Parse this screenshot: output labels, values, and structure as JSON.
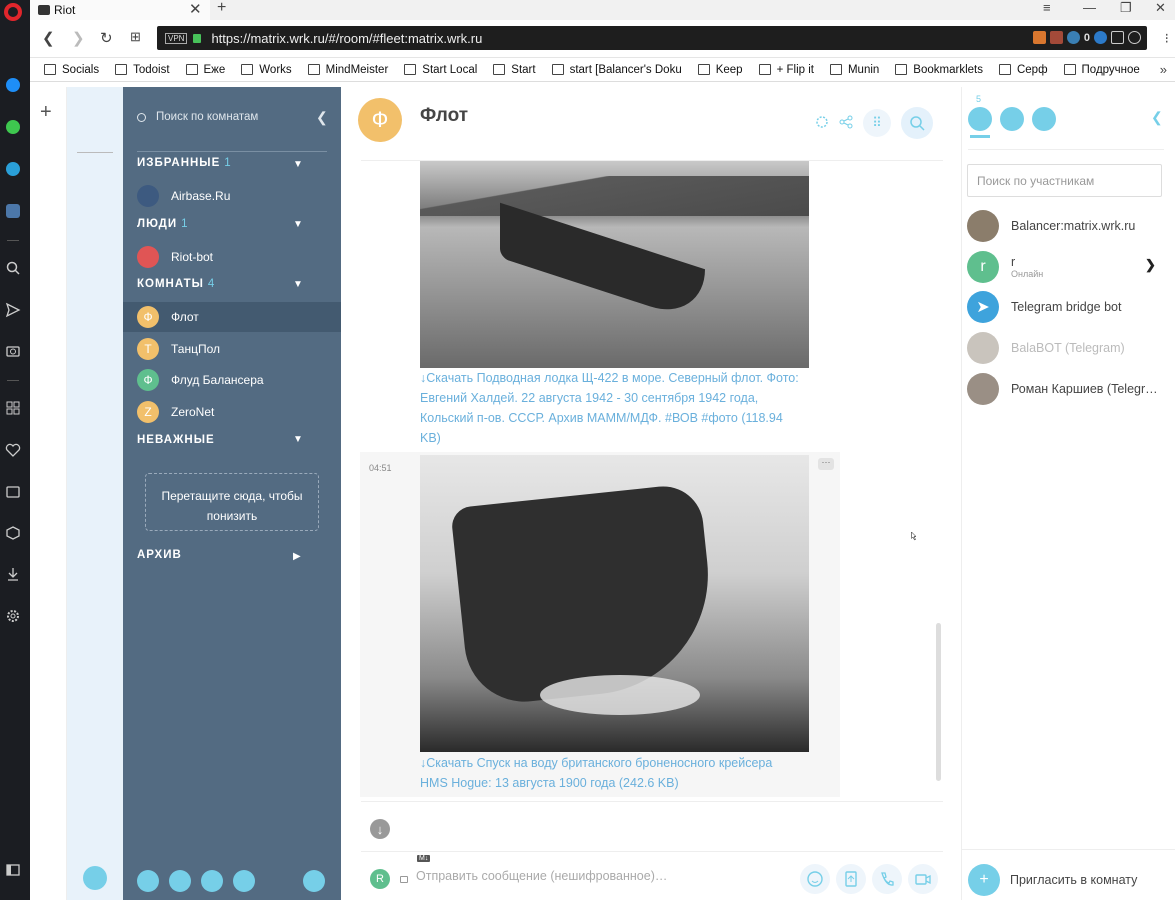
{
  "browser": {
    "tab_title": "Riot",
    "url": "https://matrix.wrk.ru/#/room/#fleet:matrix.wrk.ru",
    "vpn_label": "VPN",
    "ext_counter": "0",
    "bookmarks": [
      {
        "label": "Socials",
        "icon": "folder-icon"
      },
      {
        "label": "Todoist",
        "icon": "todoist-icon"
      },
      {
        "label": "Еже",
        "icon": "folder-icon"
      },
      {
        "label": "Works",
        "icon": "folder-icon"
      },
      {
        "label": "MindMeister",
        "icon": "mindmeister-icon"
      },
      {
        "label": "Start Local",
        "icon": "page-icon"
      },
      {
        "label": "Start",
        "icon": "home-icon"
      },
      {
        "label": "start [Balancer's Doku",
        "icon": "page-icon"
      },
      {
        "label": "Keep",
        "icon": "keep-icon"
      },
      {
        "label": "+ Flip it",
        "icon": "star-icon"
      },
      {
        "label": "Munin",
        "icon": "munin-icon"
      },
      {
        "label": "Bookmarklets",
        "icon": "folder-icon"
      },
      {
        "label": "Серф",
        "icon": "star-icon"
      },
      {
        "label": "Подручное",
        "icon": "folder-icon"
      }
    ]
  },
  "roomlist": {
    "search_placeholder": "Поиск по комнатам",
    "sections": {
      "favourites": {
        "label": "ИЗБРАННЫЕ",
        "count": "1"
      },
      "people": {
        "label": "ЛЮДИ",
        "count": "1"
      },
      "rooms": {
        "label": "КОМНАТЫ",
        "count": "4"
      },
      "low_priority": {
        "label": "НЕВАЖНЫЕ"
      },
      "archive": {
        "label": "АРХИВ"
      }
    },
    "favourite_rooms": [
      {
        "name": "Airbase.Ru"
      }
    ],
    "people": [
      {
        "name": "Riot-bot"
      }
    ],
    "rooms": [
      {
        "name": "Флот",
        "initial": "Ф",
        "color": "#f2c06b"
      },
      {
        "name": "ТанцПол",
        "initial": "Т",
        "color": "#f2c06b"
      },
      {
        "name": "Флуд Балансера",
        "initial": "Ф",
        "color": "#5fbf8e"
      },
      {
        "name": "ZeroNet",
        "initial": "Z",
        "color": "#f2c06b"
      }
    ],
    "dropzone_text": "Перетащите сюда, чтобы понизить"
  },
  "room": {
    "name": "Флот",
    "initial": "Ф",
    "messages": [
      {
        "time": "",
        "caption": "↓Скачать Подводная лодка Щ-422 в море. Северный флот. Фото: Евгений Халдей. 22 августа 1942 - 30 сентября 1942 года, Кольский п-ов. СССР. Архив МАММ/МДФ. #ВОВ #фото (118.94 KB)"
      },
      {
        "time": "04:51",
        "caption": "↓Скачать Спуск на воду британского броненосного крейсера HMS Hogue: 13 августа 1900 года (242.6 KB)"
      }
    ],
    "composer": {
      "placeholder": "Отправить сообщение (нешифрованное)…",
      "avatar_initial": "R",
      "md_label": "M↓"
    }
  },
  "members": {
    "count": "5",
    "search_placeholder": "Поиск по участникам",
    "list": [
      {
        "name": "Balancer:matrix.wrk.ru",
        "status": "",
        "dim": false
      },
      {
        "name": "r",
        "status": "Онлайн",
        "dim": false
      },
      {
        "name": "Telegram bridge bot",
        "status": "",
        "dim": false
      },
      {
        "name": "BalaBOT (Telegram)",
        "status": "",
        "dim": true
      },
      {
        "name": "Роман Каршиев (Telegr…",
        "status": "",
        "dim": false
      }
    ],
    "invite_label": "Пригласить в комнату"
  },
  "colors": {
    "accent": "#76cfe8",
    "roomlist_bg": "#536b82",
    "link": "#6ab0dc"
  }
}
